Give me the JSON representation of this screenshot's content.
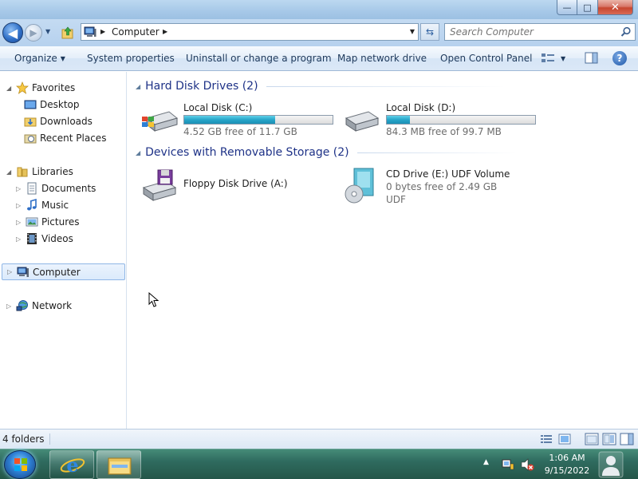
{
  "window": {
    "caption_min": "—",
    "caption_max": "□",
    "caption_close": "✕"
  },
  "address": {
    "crumb": "Computer",
    "search_placeholder": "Search Computer"
  },
  "toolbar": {
    "organize": "Organize",
    "system_properties": "System properties",
    "uninstall": "Uninstall or change a program",
    "map_network": "Map network drive",
    "open_control_panel": "Open Control Panel",
    "help": "?"
  },
  "nav": {
    "favorites": "Favorites",
    "desktop": "Desktop",
    "downloads": "Downloads",
    "recent_places": "Recent Places",
    "libraries": "Libraries",
    "documents": "Documents",
    "music": "Music",
    "pictures": "Pictures",
    "videos": "Videos",
    "computer": "Computer",
    "network": "Network"
  },
  "content": {
    "hard_disk_header": "Hard Disk Drives (2)",
    "removable_header": "Devices with Removable Storage (2)",
    "drives": [
      {
        "name": "Local Disk (C:)",
        "free_text": "4.52 GB free of 11.7 GB",
        "used_fraction": 0.614
      },
      {
        "name": "Local Disk (D:)",
        "free_text": "84.3 MB free of 99.7 MB",
        "used_fraction": 0.155
      }
    ],
    "removable": [
      {
        "name": "Floppy Disk Drive (A:)"
      },
      {
        "name": "CD Drive (E:) UDF Volume",
        "line2": "0 bytes free of 2.49 GB",
        "line3": "UDF"
      }
    ]
  },
  "status": {
    "count": "4 folders"
  },
  "taskbar": {
    "time": "1:06 AM",
    "date": "9/15/2022"
  },
  "colors": {
    "accent_header": "#1e3287",
    "bar_fill": "#27a5c9",
    "selection": "#dbeafc"
  }
}
